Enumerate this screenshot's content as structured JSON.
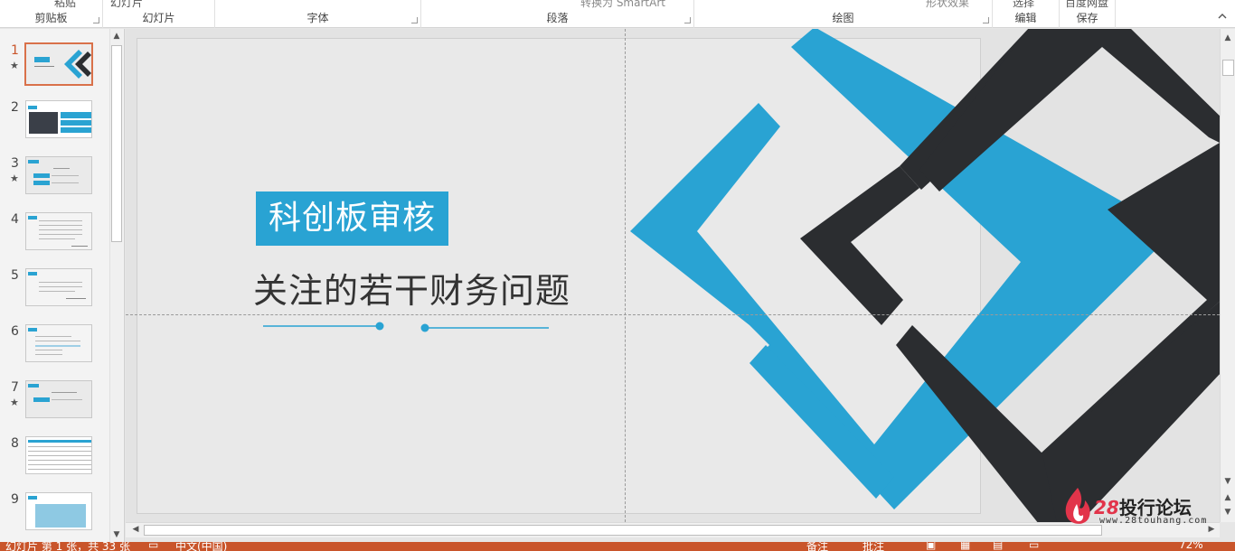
{
  "ribbon": {
    "groups": [
      {
        "label": "剪贴板",
        "top": "粘贴"
      },
      {
        "label": "幻灯片",
        "top": "幻灯片"
      },
      {
        "label": "字体",
        "top": ""
      },
      {
        "label": "段落",
        "top": "转换为 SmartArt"
      },
      {
        "label": "绘图",
        "top": "形状效果"
      },
      {
        "label": "编辑",
        "top": "选择"
      },
      {
        "label": "保存",
        "top": "百度网盘"
      }
    ]
  },
  "thumbnails": [
    {
      "num": "1",
      "star": "★"
    },
    {
      "num": "2",
      "star": ""
    },
    {
      "num": "3",
      "star": "★"
    },
    {
      "num": "4",
      "star": ""
    },
    {
      "num": "5",
      "star": ""
    },
    {
      "num": "6",
      "star": ""
    },
    {
      "num": "7",
      "star": "★"
    },
    {
      "num": "8",
      "star": ""
    },
    {
      "num": "9",
      "star": ""
    }
  ],
  "slide": {
    "title": "科创板审核",
    "subtitle": "关注的若干财务问题"
  },
  "watermark": {
    "number": "28",
    "name": "投行论坛",
    "url": "www.28touhang.com"
  },
  "status": {
    "slide_info": "幻灯片 第 1 张，共 33 张",
    "language": "中文(中国)",
    "notes": "备注",
    "comments": "批注",
    "zoom": "72%"
  },
  "colors": {
    "accent_blue": "#29a3d3",
    "dark": "#2b2d30",
    "status_bar": "#c9552b"
  }
}
